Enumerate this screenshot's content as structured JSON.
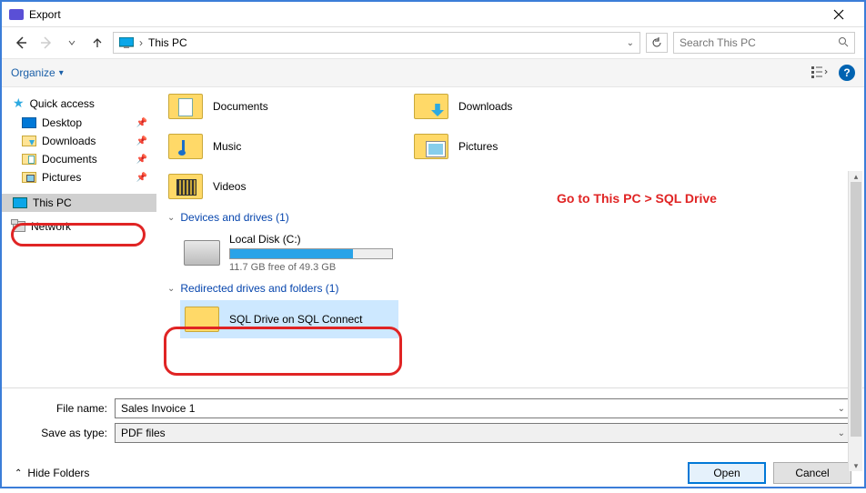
{
  "window": {
    "title": "Export"
  },
  "nav": {
    "location": "This PC",
    "search_placeholder": "Search This PC"
  },
  "toolbar": {
    "organize": "Organize"
  },
  "sidebar": {
    "quick_access": "Quick access",
    "desktop": "Desktop",
    "downloads": "Downloads",
    "documents": "Documents",
    "pictures": "Pictures",
    "this_pc": "This PC",
    "network": "Network"
  },
  "content": {
    "folders": {
      "documents": "Documents",
      "downloads": "Downloads",
      "music": "Music",
      "pictures": "Pictures",
      "videos": "Videos"
    },
    "devices_header": "Devices and drives (1)",
    "drive": {
      "name": "Local Disk (C:)",
      "free_text": "11.7 GB free of 49.3 GB",
      "fill_percent": 76
    },
    "redirected_header": "Redirected drives and folders (1)",
    "redirected_item": "SQL Drive on SQL Connect",
    "annotation": "Go to This PC > SQL Drive"
  },
  "bottom": {
    "filename_label": "File name:",
    "filename_value": "Sales Invoice 1",
    "savetype_label": "Save as type:",
    "savetype_value": "PDF files"
  },
  "footer": {
    "hide": "Hide Folders",
    "open": "Open",
    "cancel": "Cancel"
  }
}
